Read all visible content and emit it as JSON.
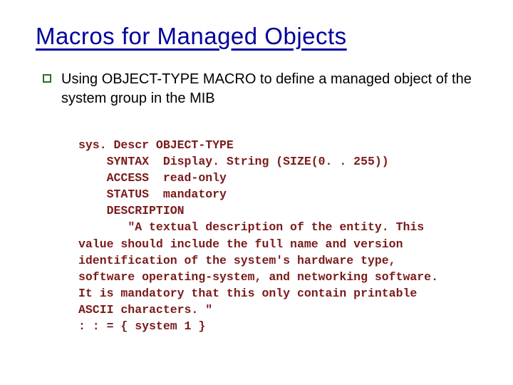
{
  "slide": {
    "title": "Macros for Managed Objects",
    "bullet": "Using OBJECT-TYPE MACRO to define a managed object of the system group in the MIB",
    "code": "sys. Descr OBJECT-TYPE\n    SYNTAX  Display. String (SIZE(0. . 255))\n    ACCESS  read-only\n    STATUS  mandatory\n    DESCRIPTION\n       \"A textual description of the entity. This\nvalue should include the full name and version\nidentification of the system's hardware type,\nsoftware operating-system, and networking software.\nIt is mandatory that this only contain printable\nASCII characters. \"\n: : = { system 1 }"
  }
}
